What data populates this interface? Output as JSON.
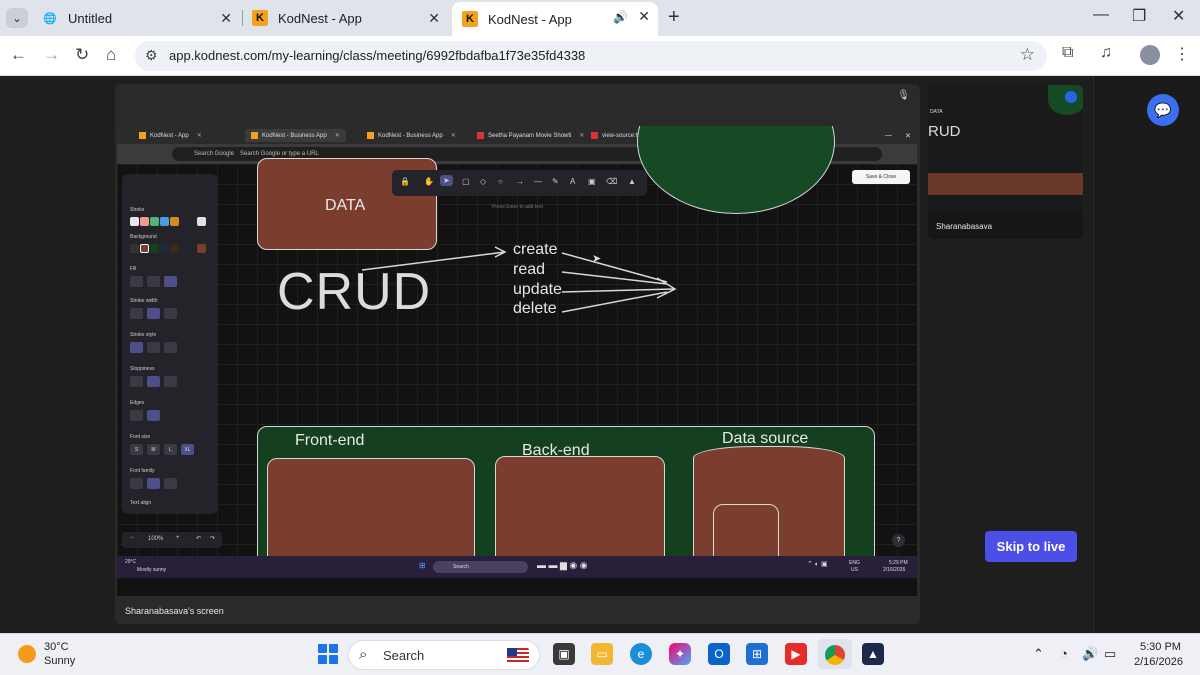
{
  "browser": {
    "tabs": [
      {
        "title": "Untitled",
        "icon": "globe-icon"
      },
      {
        "title": "KodNest - App",
        "icon": "kodnest-icon"
      },
      {
        "title": "KodNest - App",
        "icon": "kodnest-icon",
        "active": true,
        "audio": true
      }
    ],
    "url": "app.kodnest.com/my-learning/class/meeting/6992fbdafba1f73e35fd4338"
  },
  "meeting": {
    "screen_label": "Sharanabasava's screen",
    "participant_name": "Sharanabasava",
    "skip_label": "Skip to live",
    "accent": "#4b4fe6"
  },
  "shared_screen": {
    "inner_tabs": [
      "KodNest - App",
      "KodNest - Business App",
      "KodNest - Business App",
      "Seetha Payanam Movie Showti",
      "view-source:https://in.bookmy"
    ],
    "inner_search": "Search Google or type a URL",
    "inner_search_prefix": "Search Google",
    "props": {
      "stroke": "Stroke",
      "background": "Background",
      "fill": "Fill",
      "stroke_width": "Stroke width",
      "stroke_style": "Stroke style",
      "sloppiness": "Sloppiness",
      "edges": "Edges",
      "font_size": "Font size",
      "font_family": "Font family",
      "text_align": "Text align",
      "sizes": [
        "S",
        "M",
        "L",
        "XL"
      ]
    },
    "hint": "Press Enter to add text",
    "share_label": "Save & Close",
    "zoom": "100%",
    "canvas": {
      "data_box": "DATA",
      "crud": "CRUD",
      "ops": [
        "create",
        "read",
        "update",
        "delete"
      ],
      "frontend": "Front-end",
      "backend": "Back-end",
      "datasource": "Data source"
    },
    "taskbar": {
      "temp": "29°C",
      "cond": "Mostly sunny",
      "search": "Search",
      "lang1": "ENG",
      "lang2": "US",
      "time": "5:29 PM",
      "date": "2/16/2026"
    }
  },
  "taskbar": {
    "weather_temp": "30°C",
    "weather_cond": "Sunny",
    "search": "Search",
    "time": "5:30 PM",
    "date": "2/16/2026"
  }
}
